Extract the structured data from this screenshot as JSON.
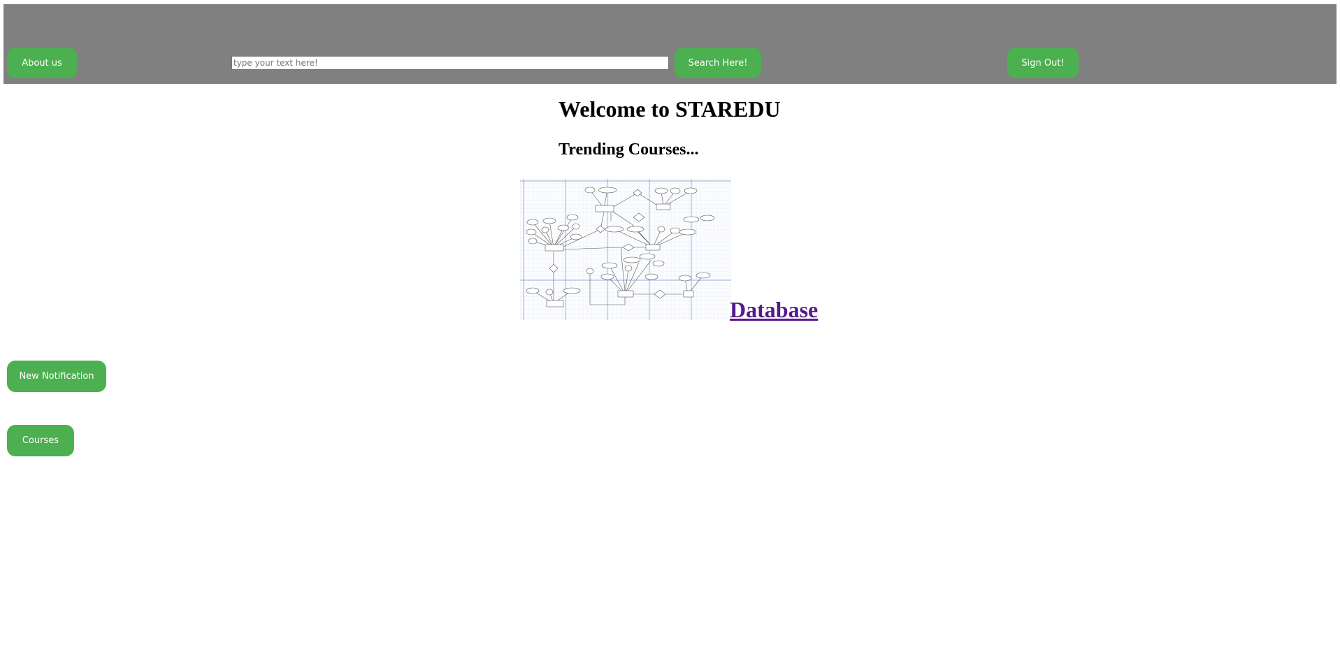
{
  "header": {
    "about_label": "About us",
    "search_placeholder": "type your text here!",
    "search_value": "",
    "search_button_label": "Search Here!",
    "signout_label": "Sign Out!",
    "background_color": "#808080",
    "button_color": "#4caf50"
  },
  "main": {
    "title": "Welcome to STAREDU",
    "subtitle": "Trending Courses...",
    "trending": [
      {
        "label": "Database",
        "thumbnail_icon": "er-diagram-image"
      }
    ]
  },
  "sidebar": {
    "notification_label": "New Notification",
    "courses_label": "Courses"
  }
}
